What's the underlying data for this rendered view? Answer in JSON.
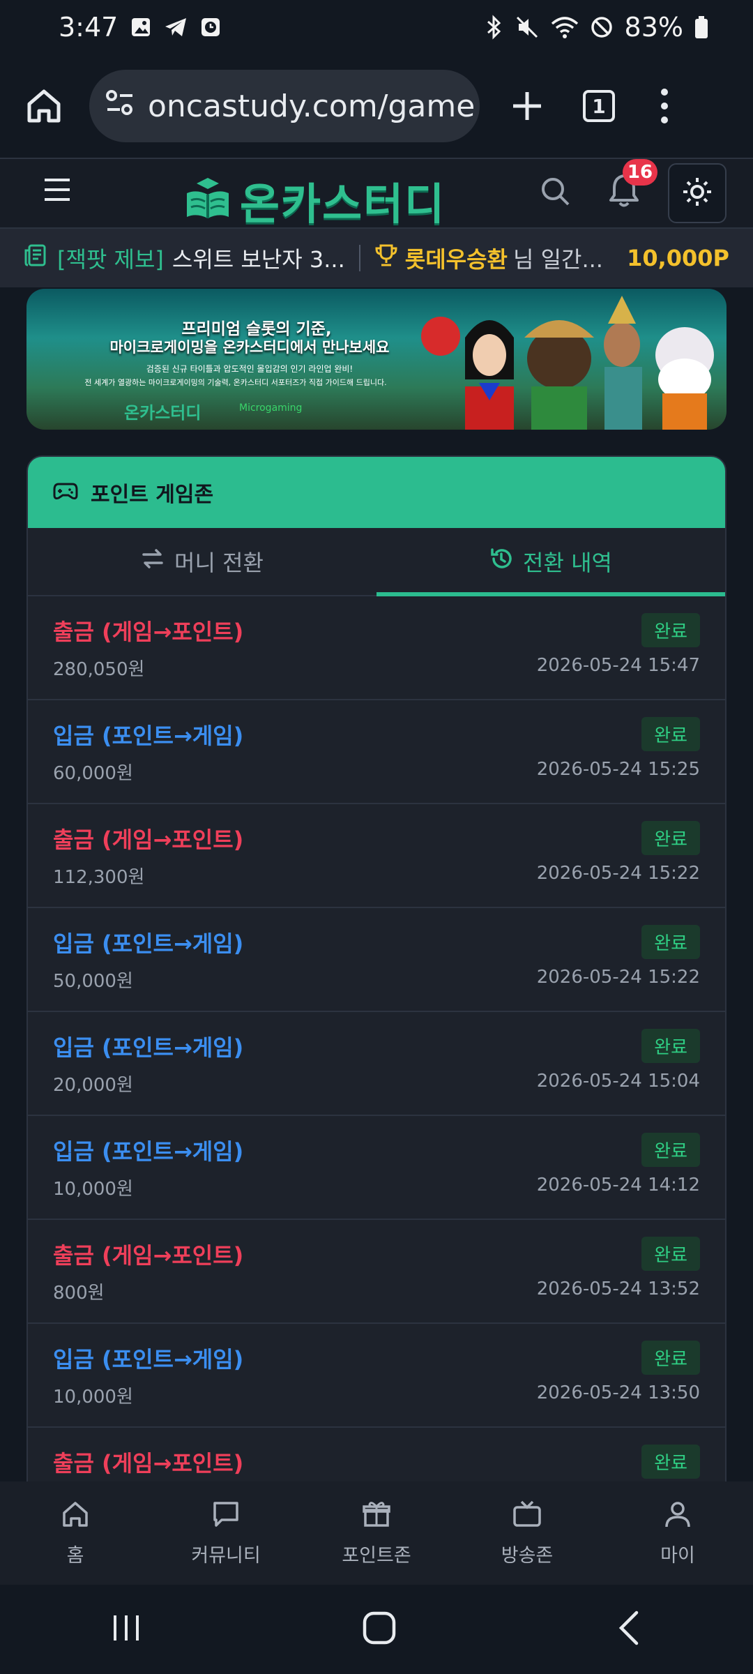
{
  "status_bar": {
    "time": "3:47",
    "battery": "83%"
  },
  "browser": {
    "url": "oncastudy.com/game",
    "tab_count": "1"
  },
  "site": {
    "logo_text": "온카스터디",
    "notification_count": "16"
  },
  "ticker": {
    "tag": "[잭팟 제보]",
    "text": "스위트 보난자 3...",
    "winner": "롯데우승환",
    "nim": "님 일간...",
    "amount": "10,000P"
  },
  "banner": {
    "line1": "프리미엄 슬롯의 기준,",
    "line2": "마이크로게이밍을 온카스터디에서 만나보세요",
    "line3": "검증된 신규 타이틀과 압도적인 몰입감의 인기 라인업 완비!",
    "line4": "전 세계가 열광하는 마이크로게이밍의 기술력, 온카스터디 서포터즈가 직접 가이드해 드립니다.",
    "logo": "온카스터디",
    "partner": "Microgaming"
  },
  "card": {
    "title": "포인트 게임존",
    "tabs": [
      {
        "label": "머니 전환",
        "icon": "swap-icon"
      },
      {
        "label": "전환 내역",
        "icon": "history-icon"
      }
    ],
    "rows": [
      {
        "type": "출금 (게임→포인트)",
        "kind": "out",
        "amount": "280,050원",
        "status": "완료",
        "date": "2026-05-24 15:47"
      },
      {
        "type": "입금 (포인트→게임)",
        "kind": "in",
        "amount": "60,000원",
        "status": "완료",
        "date": "2026-05-24 15:25"
      },
      {
        "type": "출금 (게임→포인트)",
        "kind": "out",
        "amount": "112,300원",
        "status": "완료",
        "date": "2026-05-24 15:22"
      },
      {
        "type": "입금 (포인트→게임)",
        "kind": "in",
        "amount": "50,000원",
        "status": "완료",
        "date": "2026-05-24 15:22"
      },
      {
        "type": "입금 (포인트→게임)",
        "kind": "in",
        "amount": "20,000원",
        "status": "완료",
        "date": "2026-05-24 15:04"
      },
      {
        "type": "입금 (포인트→게임)",
        "kind": "in",
        "amount": "10,000원",
        "status": "완료",
        "date": "2026-05-24 14:12"
      },
      {
        "type": "출금 (게임→포인트)",
        "kind": "out",
        "amount": "800원",
        "status": "완료",
        "date": "2026-05-24 13:52"
      },
      {
        "type": "입금 (포인트→게임)",
        "kind": "in",
        "amount": "10,000원",
        "status": "완료",
        "date": "2026-05-24 13:50"
      },
      {
        "type": "출금 (게임→포인트)",
        "kind": "out",
        "amount": "",
        "status": "완료",
        "date": ""
      }
    ]
  },
  "bottom_nav": [
    {
      "label": "홈",
      "icon": "home-icon"
    },
    {
      "label": "커뮤니티",
      "icon": "chat-icon"
    },
    {
      "label": "포인트존",
      "icon": "gift-icon"
    },
    {
      "label": "방송존",
      "icon": "tv-icon"
    },
    {
      "label": "마이",
      "icon": "user-icon"
    }
  ],
  "colors": {
    "accent": "#2cbc8f",
    "withdraw": "#ef3f5a",
    "deposit": "#3b8ef0",
    "complete": "#2fcf84"
  }
}
